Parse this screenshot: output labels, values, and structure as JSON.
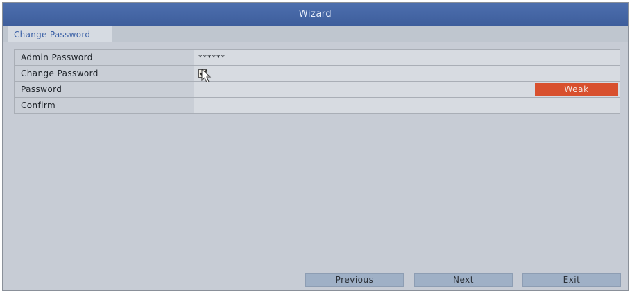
{
  "window": {
    "title": "Wizard"
  },
  "tabs": [
    {
      "label": "Change Password",
      "active": true
    }
  ],
  "form": {
    "admin_password": {
      "label": "Admin Password",
      "value": "******"
    },
    "change_password": {
      "label": "Change Password",
      "checked": true
    },
    "password": {
      "label": "Password",
      "value": "",
      "strength": "Weak"
    },
    "confirm": {
      "label": "Confirm",
      "value": ""
    }
  },
  "buttons": {
    "previous": "Previous",
    "next": "Next",
    "exit": "Exit"
  },
  "colors": {
    "titlebar": "#4466a6",
    "tab_text": "#3a60a6",
    "strength_weak": "#d8502e",
    "button_bg": "#9fb0c6"
  }
}
